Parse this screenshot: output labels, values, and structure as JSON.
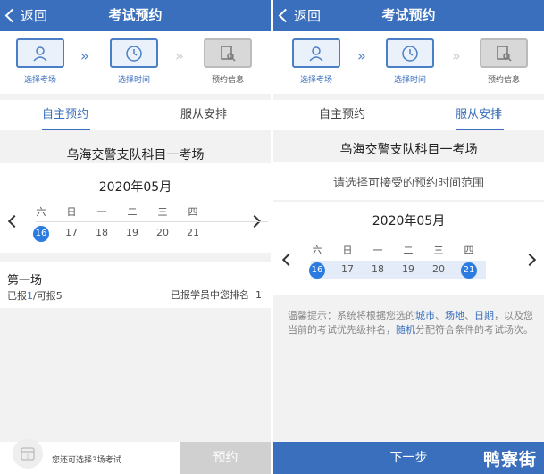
{
  "left": {
    "header": {
      "back_label": "返回",
      "title": "考试预约"
    },
    "steps": [
      {
        "label": "选择考场"
      },
      {
        "label": "选择时间"
      },
      {
        "label": "预约信息"
      }
    ],
    "tabs": [
      {
        "label": "自主预约"
      },
      {
        "label": "服从安排"
      }
    ],
    "venue": "乌海交警支队科目一考场",
    "month": "2020年05月",
    "weekdays": [
      "六",
      "日",
      "一",
      "二",
      "三",
      "四"
    ],
    "dates": [
      "16",
      "17",
      "18",
      "19",
      "20",
      "21"
    ],
    "session": {
      "name": "第一场",
      "reported_prefix": "已报",
      "reported_num": "1",
      "capacity": "/可报5",
      "rank_text": "已报学员中您排名",
      "rank": "1"
    },
    "footer": {
      "remaining_text": "您还可选择3场考试",
      "button": "预约"
    }
  },
  "right": {
    "header": {
      "back_label": "返回",
      "title": "考试预约"
    },
    "steps": [
      {
        "label": "选择考场"
      },
      {
        "label": "选择时间"
      },
      {
        "label": "预约信息"
      }
    ],
    "tabs": [
      {
        "label": "自主预约"
      },
      {
        "label": "服从安排"
      }
    ],
    "venue": "乌海交警支队科目一考场",
    "range_prompt": "请选择可接受的预约时间范围",
    "month": "2020年05月",
    "weekdays": [
      "六",
      "日",
      "一",
      "二",
      "三",
      "四"
    ],
    "dates": [
      "16",
      "17",
      "18",
      "19",
      "20",
      "21"
    ],
    "tip": {
      "p1": "温馨提示：系统将根据您选的",
      "city": "城市",
      "s1": "、",
      "site": "场地",
      "s2": "、",
      "date": "日期",
      "p2": "，以及您当前的考试优先级排名，",
      "random": "随机",
      "p3": "分配符合条件的考试场次。"
    },
    "footer": {
      "button": "下一步"
    },
    "watermark": "鸭寮街"
  },
  "colors": {
    "primary": "#3a6fbd",
    "accent": "#2c7be0",
    "disabled_button": "#d0d0d0"
  }
}
